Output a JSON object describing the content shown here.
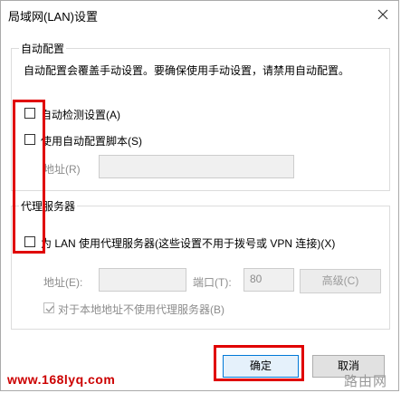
{
  "window": {
    "title": "局域网(LAN)设置"
  },
  "auto_config": {
    "group_label": "自动配置",
    "description": "自动配置会覆盖手动设置。要确保使用手动设置，请禁用自动配置。",
    "auto_detect_label": "自动检测设置(A)",
    "auto_detect_checked": false,
    "use_script_label": "使用自动配置脚本(S)",
    "use_script_checked": false,
    "address_label": "地址(R)",
    "address_value": ""
  },
  "proxy": {
    "group_label": "代理服务器",
    "use_proxy_label": "为 LAN 使用代理服务器(这些设置不用于拨号或 VPN 连接)(X)",
    "use_proxy_checked": false,
    "address_label": "地址(E):",
    "address_value": "",
    "port_label": "端口(T):",
    "port_value": "80",
    "advanced_label": "高级(C)",
    "bypass_local_label": "对于本地地址不使用代理服务器(B)",
    "bypass_local_checked": true
  },
  "buttons": {
    "ok_label": "确定",
    "cancel_label": "取消"
  },
  "watermark": {
    "site": "www.168lyq.com",
    "logo_text": "路由网"
  },
  "colors": {
    "annotation": "#e00000",
    "primary_border": "#0078d7"
  },
  "icons": {
    "close": "close-icon",
    "check": "check-icon"
  }
}
